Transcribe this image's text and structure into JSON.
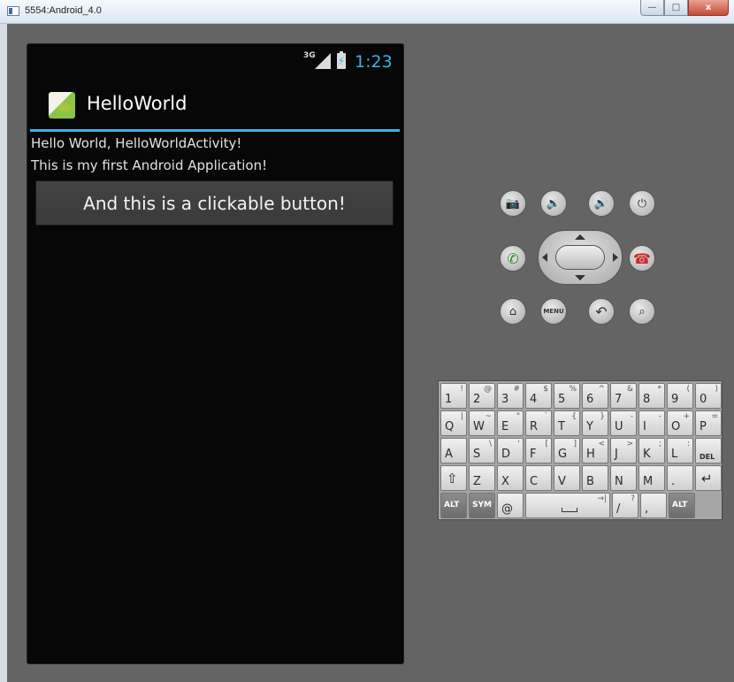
{
  "window": {
    "title": "5554:Android_4.0",
    "min_label": "—",
    "max_label": "□",
    "close_label": "x"
  },
  "status_bar": {
    "network": "3G",
    "time": "1:23",
    "accent_color": "#33b5e5"
  },
  "action_bar": {
    "app_name": "HelloWorld",
    "icon": "android-app-icon"
  },
  "content": {
    "line1": "Hello World, HelloWorldActivity!",
    "line2": "This is my first Android Application!",
    "button_label": "And this is a clickable button!"
  },
  "hardware": {
    "top_row": [
      "camera-icon",
      "volume-down-icon",
      "volume-up-icon",
      "power-icon"
    ],
    "middle_row": [
      "call-icon",
      "dpad",
      "end-call-icon"
    ],
    "bottom_row": [
      "home-icon",
      "menu-button",
      "back-icon",
      "search-icon"
    ],
    "menu_label": "MENU"
  },
  "keyboard": {
    "row1": [
      {
        "main": "1",
        "alt": "!"
      },
      {
        "main": "2",
        "alt": "@"
      },
      {
        "main": "3",
        "alt": "#"
      },
      {
        "main": "4",
        "alt": "$"
      },
      {
        "main": "5",
        "alt": "%"
      },
      {
        "main": "6",
        "alt": "^"
      },
      {
        "main": "7",
        "alt": "&"
      },
      {
        "main": "8",
        "alt": "*"
      },
      {
        "main": "9",
        "alt": "("
      },
      {
        "main": "0",
        "alt": ")"
      }
    ],
    "row2": [
      {
        "main": "Q",
        "alt": "|"
      },
      {
        "main": "W",
        "alt": "~"
      },
      {
        "main": "E",
        "alt": "\""
      },
      {
        "main": "R",
        "alt": "`"
      },
      {
        "main": "T",
        "alt": "{"
      },
      {
        "main": "Y",
        "alt": "}"
      },
      {
        "main": "U",
        "alt": "-"
      },
      {
        "main": "I",
        "alt": "-"
      },
      {
        "main": "O",
        "alt": "+"
      },
      {
        "main": "P",
        "alt": "="
      }
    ],
    "row3": [
      {
        "main": "A",
        "alt": ""
      },
      {
        "main": "S",
        "alt": "\\"
      },
      {
        "main": "D",
        "alt": "'"
      },
      {
        "main": "F",
        "alt": "["
      },
      {
        "main": "G",
        "alt": "]"
      },
      {
        "main": "H",
        "alt": "<"
      },
      {
        "main": "J",
        "alt": ">"
      },
      {
        "main": "K",
        "alt": ";"
      },
      {
        "main": "L",
        "alt": ":"
      },
      {
        "main": "DEL",
        "alt": ""
      }
    ],
    "row4": [
      {
        "main": "⇧",
        "alt": ""
      },
      {
        "main": "Z",
        "alt": ""
      },
      {
        "main": "X",
        "alt": ""
      },
      {
        "main": "C",
        "alt": ""
      },
      {
        "main": "V",
        "alt": ""
      },
      {
        "main": "B",
        "alt": ""
      },
      {
        "main": "N",
        "alt": ""
      },
      {
        "main": "M",
        "alt": ""
      },
      {
        "main": ".",
        "alt": ""
      },
      {
        "main": "↵",
        "alt": ""
      }
    ],
    "row5": {
      "alt_left": "ALT",
      "sym": "SYM",
      "at": "@",
      "tab": "→|",
      "slash": "/",
      "slash_alt": "?",
      "comma": ",",
      "alt_right": "ALT"
    }
  }
}
